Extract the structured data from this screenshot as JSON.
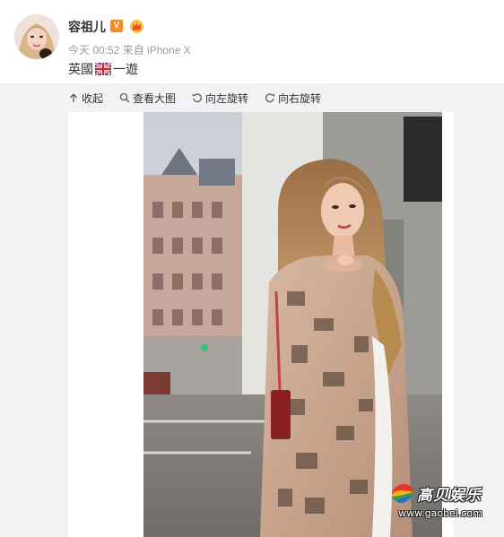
{
  "post": {
    "username": "容祖儿",
    "verified_badge": "V",
    "meta": "今天 00:52 来自 iPhone X",
    "text_before_flag": "英國",
    "text_after_flag": "一遊"
  },
  "icons": {
    "verified": "verified-v-icon",
    "member": "crown-member-icon",
    "flag": "uk-flag-icon"
  },
  "toolbar": {
    "collapse": "收起",
    "view_large": "查看大图",
    "rotate_left": "向左旋转",
    "rotate_right": "向右旋转"
  },
  "watermark": {
    "brand": "高贝娱乐",
    "url": "www.gaobei.com"
  },
  "colors": {
    "accent_orange": "#f78b1e",
    "viewer_bg": "#f2f2f5",
    "meta_text": "#999999"
  }
}
